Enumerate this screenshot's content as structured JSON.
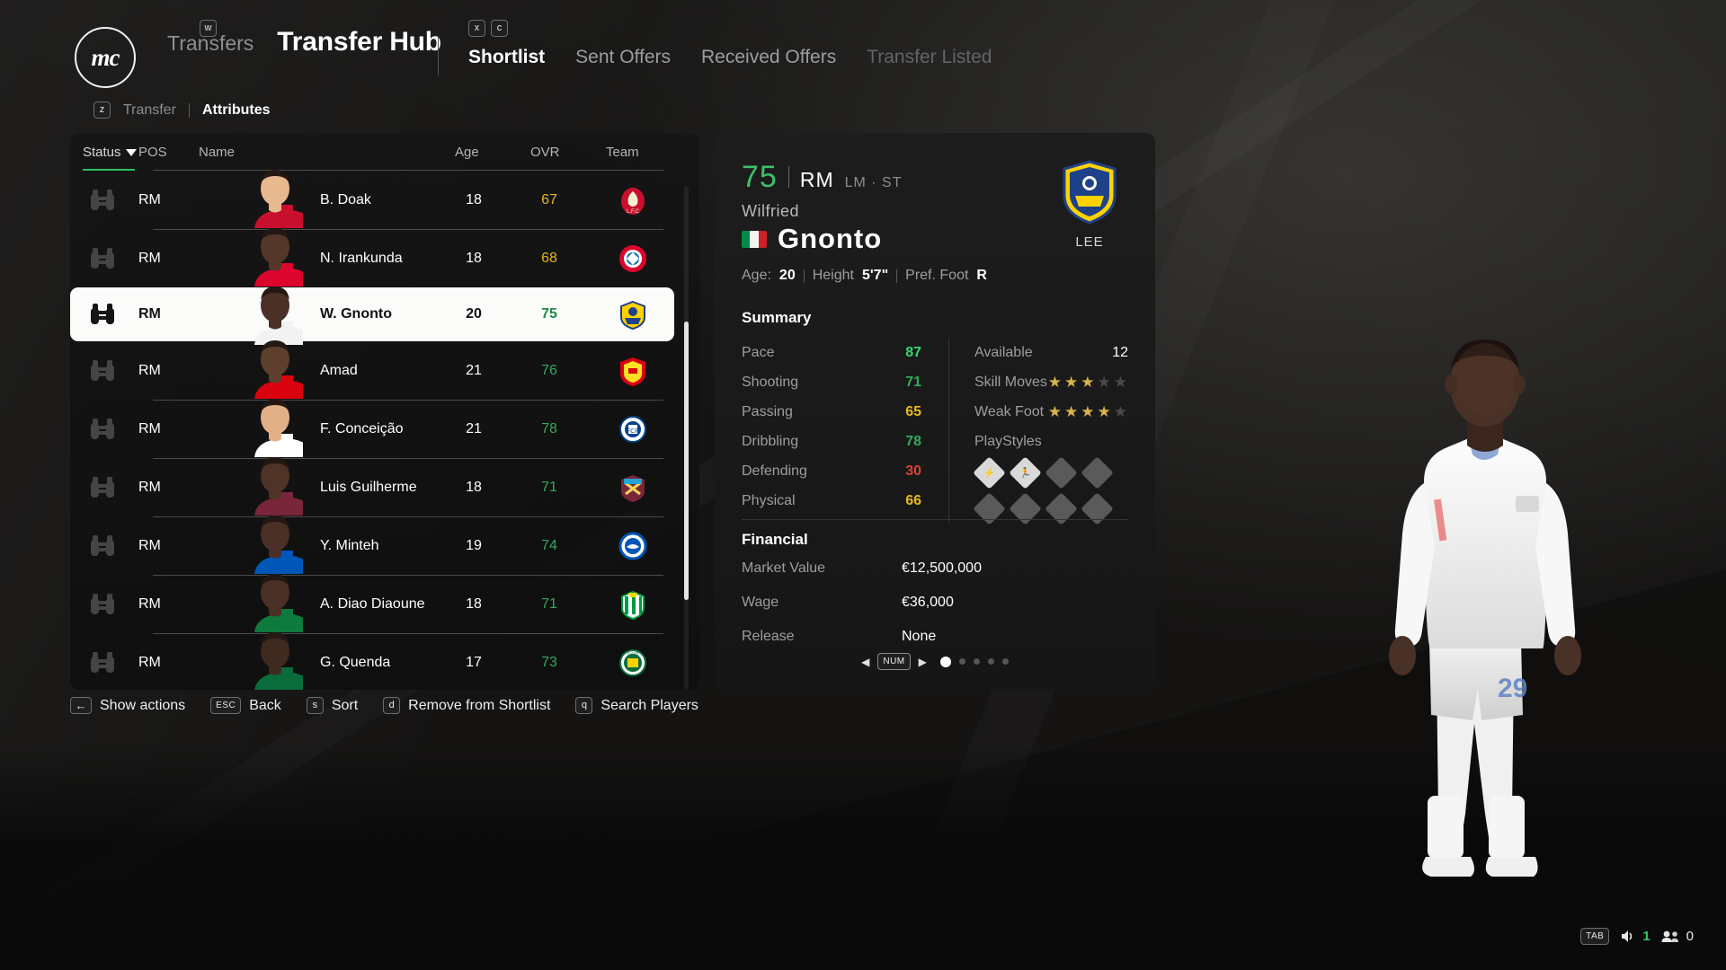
{
  "header": {
    "crest_text": "mc",
    "breadcrumb": "Transfers",
    "breadcrumb_key": "w",
    "title": "Transfer Hub",
    "tabs_keys": [
      "x",
      "c"
    ],
    "tabs": [
      {
        "label": "Shortlist",
        "state": "active"
      },
      {
        "label": "Sent Offers",
        "state": "normal"
      },
      {
        "label": "Received Offers",
        "state": "normal"
      },
      {
        "label": "Transfer Listed",
        "state": "dim"
      }
    ],
    "subnav_key": "z",
    "subtabs": [
      {
        "label": "Transfer",
        "state": "normal"
      },
      {
        "label": "Attributes",
        "state": "active"
      }
    ]
  },
  "list": {
    "columns": {
      "status": "Status",
      "pos": "POS",
      "name": "Name",
      "age": "Age",
      "ovr": "OVR",
      "team": "Team"
    },
    "sorted_by": "Status",
    "sort_direction": "desc",
    "rows": [
      {
        "status_icon": "binoculars-icon",
        "pos": "RM",
        "name": "B. Doak",
        "age": "18",
        "ovr": "67",
        "ovr_color": "gold",
        "team": "LFC",
        "selected": false
      },
      {
        "status_icon": "binoculars-icon",
        "pos": "RM",
        "name": "N. Irankunda",
        "age": "18",
        "ovr": "68",
        "ovr_color": "gold",
        "team": "FCB",
        "selected": false
      },
      {
        "status_icon": "binoculars-icon",
        "pos": "RM",
        "name": "W. Gnonto",
        "age": "20",
        "ovr": "75",
        "ovr_color": "green",
        "team": "LEE",
        "selected": true
      },
      {
        "status_icon": "binoculars-icon",
        "pos": "RM",
        "name": "Amad",
        "age": "21",
        "ovr": "76",
        "ovr_color": "green",
        "team": "MUN",
        "selected": false
      },
      {
        "status_icon": "binoculars-icon",
        "pos": "RM",
        "name": "F. Conceição",
        "age": "21",
        "ovr": "78",
        "ovr_color": "green",
        "team": "POR",
        "selected": false
      },
      {
        "status_icon": "binoculars-icon",
        "pos": "RM",
        "name": "Luis Guilherme",
        "age": "18",
        "ovr": "71",
        "ovr_color": "green",
        "team": "WHU",
        "selected": false
      },
      {
        "status_icon": "binoculars-icon",
        "pos": "RM",
        "name": "Y. Minteh",
        "age": "19",
        "ovr": "74",
        "ovr_color": "green",
        "team": "BHA",
        "selected": false
      },
      {
        "status_icon": "binoculars-icon",
        "pos": "RM",
        "name": "A. Diao Diaoune",
        "age": "18",
        "ovr": "71",
        "ovr_color": "green",
        "team": "BET",
        "selected": false
      },
      {
        "status_icon": "binoculars-icon",
        "pos": "RM",
        "name": "G. Quenda",
        "age": "17",
        "ovr": "73",
        "ovr_color": "green",
        "team": "SCP",
        "selected": false
      }
    ]
  },
  "actions": [
    {
      "key": "←",
      "key_type": "arrow",
      "label": "Show actions"
    },
    {
      "key": "ESC",
      "key_type": "pill",
      "label": "Back"
    },
    {
      "key": "s",
      "key_type": "cap",
      "label": "Sort"
    },
    {
      "key": "d",
      "key_type": "cap",
      "label": "Remove from Shortlist"
    },
    {
      "key": "q",
      "key_type": "cap",
      "label": "Search Players"
    }
  ],
  "detail": {
    "rating": "75",
    "position_main": "RM",
    "positions_alt": "LM · ST",
    "first_name": "Wilfried",
    "last_name": "Gnonto",
    "nationality": "Italy",
    "club_code": "LEE",
    "bio": {
      "age_label": "Age:",
      "age_value": "20",
      "height_label": "Height",
      "height_value": "5'7\"",
      "foot_label": "Pref. Foot",
      "foot_value": "R"
    },
    "summary_title": "Summary",
    "summary_left": [
      {
        "label": "Pace",
        "value": "87",
        "color": "green-bright"
      },
      {
        "label": "Shooting",
        "value": "71",
        "color": "green"
      },
      {
        "label": "Passing",
        "value": "65",
        "color": "gold"
      },
      {
        "label": "Dribbling",
        "value": "78",
        "color": "green"
      },
      {
        "label": "Defending",
        "value": "30",
        "color": "red"
      },
      {
        "label": "Physical",
        "value": "66",
        "color": "gold"
      }
    ],
    "summary_right": {
      "available_label": "Available",
      "available_value": "12",
      "skill_moves_label": "Skill Moves",
      "skill_moves": 3,
      "weak_foot_label": "Weak Foot",
      "weak_foot": 4,
      "playstyles_label": "PlayStyles",
      "playstyles_total": 8,
      "playstyles_filled": 2
    },
    "financial_title": "Financial",
    "financial": [
      {
        "label": "Market Value",
        "value": "€12,500,000"
      },
      {
        "label": "Wage",
        "value": "€36,000"
      },
      {
        "label": "Release",
        "value": "None"
      }
    ],
    "pager": {
      "key": "NUM",
      "pages": 5,
      "current": 1
    }
  },
  "hud": {
    "key": "TAB",
    "audio_count": "1",
    "players_count": "0"
  },
  "colors": {
    "accent_green": "#2fbf5c",
    "gold": "#e7b81e",
    "red": "#d8412f",
    "selected_row_bg": "#fbfbfa"
  }
}
